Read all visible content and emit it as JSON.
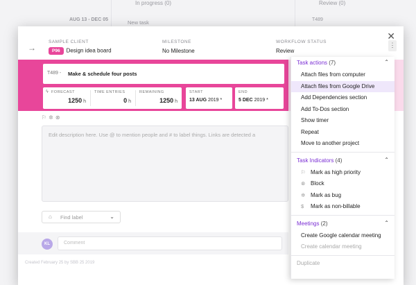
{
  "background": {
    "col_date": "AUG 13 - DEC 05",
    "col_progress": "In progress (0)",
    "col_review": "Review (0)",
    "new_task": "New task",
    "t_label": "T489"
  },
  "header": {
    "client_label": "SAMPLE CLIENT",
    "project_badge": "P96",
    "project_name": "Design idea board",
    "milestone_label": "MILESTONE",
    "milestone_value": "No Milestone",
    "workflow_label": "WORKFLOW STATUS",
    "workflow_value": "Review"
  },
  "task": {
    "id": "T489 -",
    "title": "Make & schedule four posts"
  },
  "stats": {
    "forecast_label": "FORECAST",
    "forecast_value": "1250",
    "time_label": "TIME ENTRIES",
    "time_value": "0",
    "remaining_label": "REMAINING",
    "remaining_value": "1250",
    "unit": "h",
    "start_label": "START",
    "start_day": "13 AUG",
    "start_year": "2019 *",
    "end_label": "END",
    "end_day": "5 DEC",
    "end_year": "2019 *"
  },
  "description": {
    "placeholder": "Edit description here. Use @ to mention people and # to label things. Links are detected a"
  },
  "label_select": {
    "placeholder": "Find label"
  },
  "comment": {
    "avatar_initials": "KL",
    "placeholder": "Comment"
  },
  "footer_text": "Created February 25 by SBB 25 2019",
  "menu": {
    "task_actions": {
      "title": "Task actions",
      "count": "(7)",
      "items": [
        "Attach files from computer",
        "Attach files from Google Drive",
        "Add Dependencies section",
        "Add To-Dos section",
        "Show timer",
        "Repeat",
        "Move to another project"
      ]
    },
    "task_indicators": {
      "title": "Task Indicators",
      "count": "(4)",
      "items": [
        "Mark as high priority",
        "Block",
        "Mark as bug",
        "Mark as non-billable"
      ]
    },
    "meetings": {
      "title": "Meetings",
      "count": "(2)",
      "items": [
        "Create Google calendar meeting",
        "Create calendar meeting"
      ]
    },
    "duplicate": "Duplicate"
  },
  "colors": {
    "accent_pink": "#e8469a",
    "accent_purple": "#7b2fd4",
    "highlight": "#efe7fb"
  }
}
